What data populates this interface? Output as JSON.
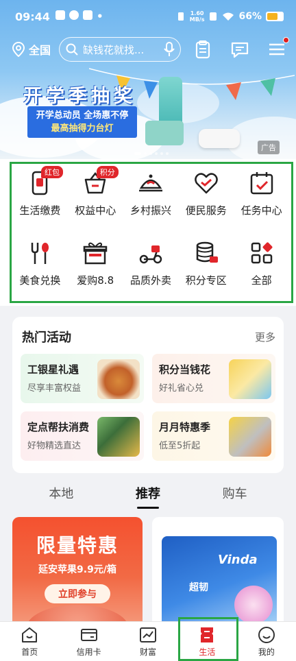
{
  "status_bar": {
    "time": "09:44",
    "network_speed_top": "1.60",
    "network_speed_bottom": "MB/s",
    "battery": "66%"
  },
  "top_nav": {
    "location": "全国",
    "search_placeholder": "缺钱花就找..."
  },
  "banner": {
    "title": "开学季抽奖",
    "line1": "开学总动员 全场惠不停",
    "line2": "最高抽得力台灯",
    "ad_label": "广告"
  },
  "grid": {
    "items": [
      {
        "label": "生活缴费",
        "badge": "红包"
      },
      {
        "label": "权益中心",
        "badge": "积分"
      },
      {
        "label": "乡村振兴"
      },
      {
        "label": "便民服务"
      },
      {
        "label": "任务中心"
      },
      {
        "label": "美食兑换"
      },
      {
        "label": "爱购8.8"
      },
      {
        "label": "品质外卖"
      },
      {
        "label": "积分专区"
      },
      {
        "label": "全部"
      }
    ]
  },
  "hot": {
    "title": "热门活动",
    "more": "更多",
    "items": [
      {
        "title": "工银星礼遇",
        "sub": "尽享丰富权益"
      },
      {
        "title": "积分当钱花",
        "sub": "好礼省心兑"
      },
      {
        "title": "定点帮扶消费",
        "sub": "好物精选直达"
      },
      {
        "title": "月月特惠季",
        "sub": "低至5折起"
      }
    ]
  },
  "tabs": {
    "items": [
      "本地",
      "推荐",
      "购车"
    ],
    "active": "推荐"
  },
  "feed": {
    "card1_title": "限量特惠",
    "card1_sub": "延安苹果9.9元/箱",
    "card1_button": "立即参与",
    "card2_brand": "Vinda",
    "card2_product": "超韧"
  },
  "bottom_nav": {
    "items": [
      "首页",
      "信用卡",
      "财富",
      "生活",
      "我的"
    ],
    "active": "生活"
  },
  "colors": {
    "accent_red": "#e0262b",
    "highlight_green": "#2aa644",
    "banner_blue": "#6db4ee"
  }
}
